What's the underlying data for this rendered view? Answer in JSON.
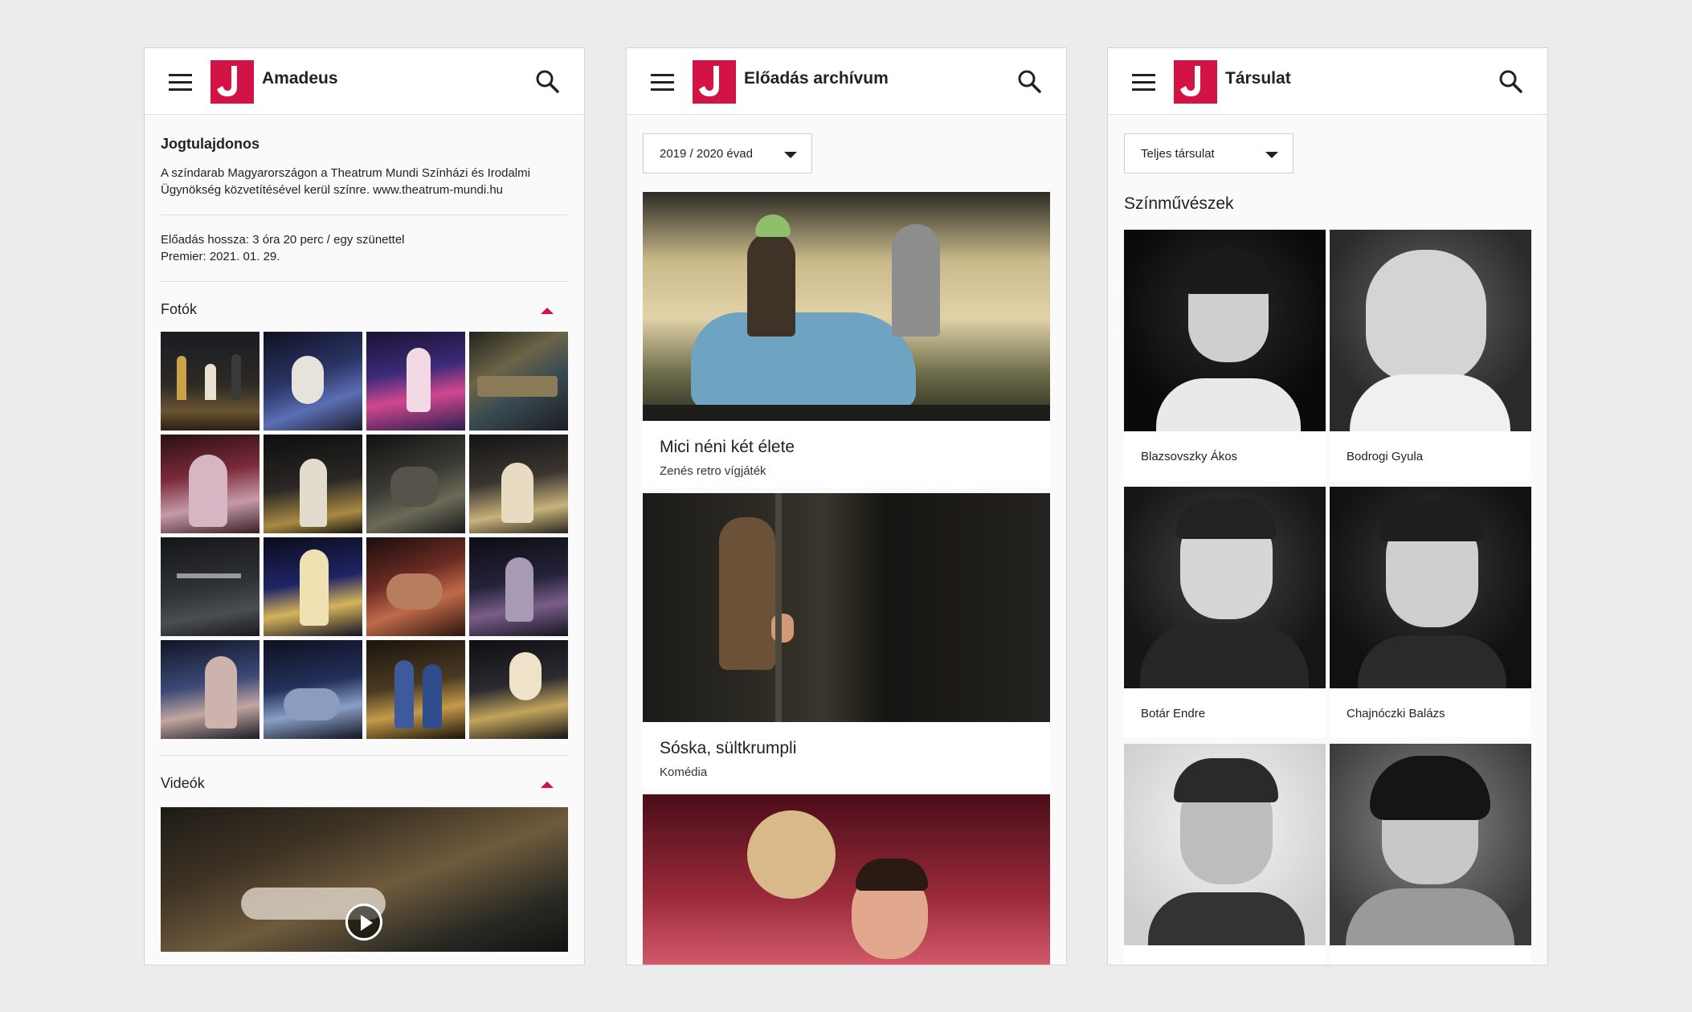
{
  "brand": {
    "accent": "#d31245"
  },
  "screen1": {
    "title": "Amadeus",
    "rights_heading": "Jogtulajdonos",
    "rights_text_line1": "A színdarab Magyarországon a Theatrum Mundi Színházi és Irodalmi",
    "rights_text_line2": "Ügynökség közvetítésével kerül színre. www.theatrum-mundi.hu",
    "length": "Előadás hossza: 3 óra 20 perc / egy szünettel",
    "premiere": "Premier: 2021. 01. 29.",
    "photos_label": "Fotók",
    "videos_label": "Videók",
    "photo_count": 16
  },
  "screen2": {
    "title": "Előadás archívum",
    "season_select": "2019 / 2020 évad",
    "shows": [
      {
        "title": "Mici néni két élete",
        "subtitle": "Zenés retro vígjáték"
      },
      {
        "title": "Sóska, sültkrumpli",
        "subtitle": "Komédia"
      },
      {
        "title": "",
        "subtitle": ""
      }
    ]
  },
  "screen3": {
    "title": "Társulat",
    "company_select": "Teljes társulat",
    "section_heading": "Színművészek",
    "actors": [
      {
        "name": "Blazsovszky Ákos"
      },
      {
        "name": "Bodrogi Gyula"
      },
      {
        "name": "Botár Endre"
      },
      {
        "name": "Chajnóczki Balázs"
      },
      {
        "name": ""
      },
      {
        "name": ""
      }
    ]
  }
}
